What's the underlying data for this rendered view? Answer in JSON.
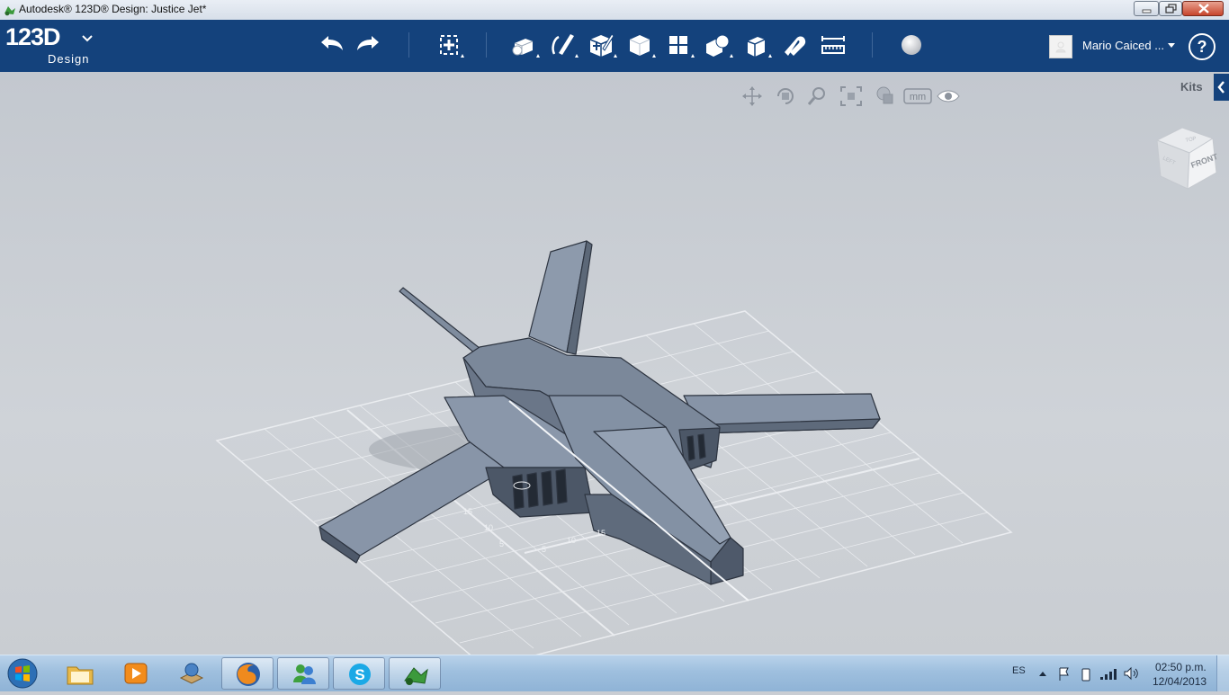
{
  "window": {
    "title": "Autodesk® 123D® Design: Justice Jet*",
    "controls": [
      "minimize",
      "maximize",
      "close"
    ]
  },
  "toolbar": {
    "logo_main": "123D",
    "logo_sub": "Design",
    "tools": [
      {
        "name": "undo-icon"
      },
      {
        "name": "redo-icon"
      },
      {
        "name": "transform-icon"
      },
      {
        "name": "primitives-icon"
      },
      {
        "name": "sketch-icon"
      },
      {
        "name": "construct-icon"
      },
      {
        "name": "modify-icon"
      },
      {
        "name": "pattern-icon"
      },
      {
        "name": "grouping-icon"
      },
      {
        "name": "combine-icon"
      },
      {
        "name": "snap-icon"
      },
      {
        "name": "measure-icon"
      },
      {
        "name": "material-icon"
      }
    ],
    "user_name": "Mario Caiced ...",
    "help_label": "?"
  },
  "viewport": {
    "units_label": "mm",
    "kits_label": "Kits",
    "viewcube_front": "FRONT",
    "viewcube_top": "TOP",
    "viewcube_left": "LEFT",
    "grid_labels": [
      "15",
      "10",
      "5",
      "5",
      "10",
      "15"
    ]
  },
  "taskbar": {
    "apps": [
      "start-orb",
      "windows-explorer",
      "media-player",
      "desktop-app",
      "firefox",
      "messenger",
      "skype",
      "123d-design"
    ],
    "language": "ES",
    "time": "02:50 p.m.",
    "date": "12/04/2013"
  },
  "colors": {
    "toolbar": "#14427c",
    "model": "#7d8a9d",
    "viewport": "#c9cdd3"
  }
}
